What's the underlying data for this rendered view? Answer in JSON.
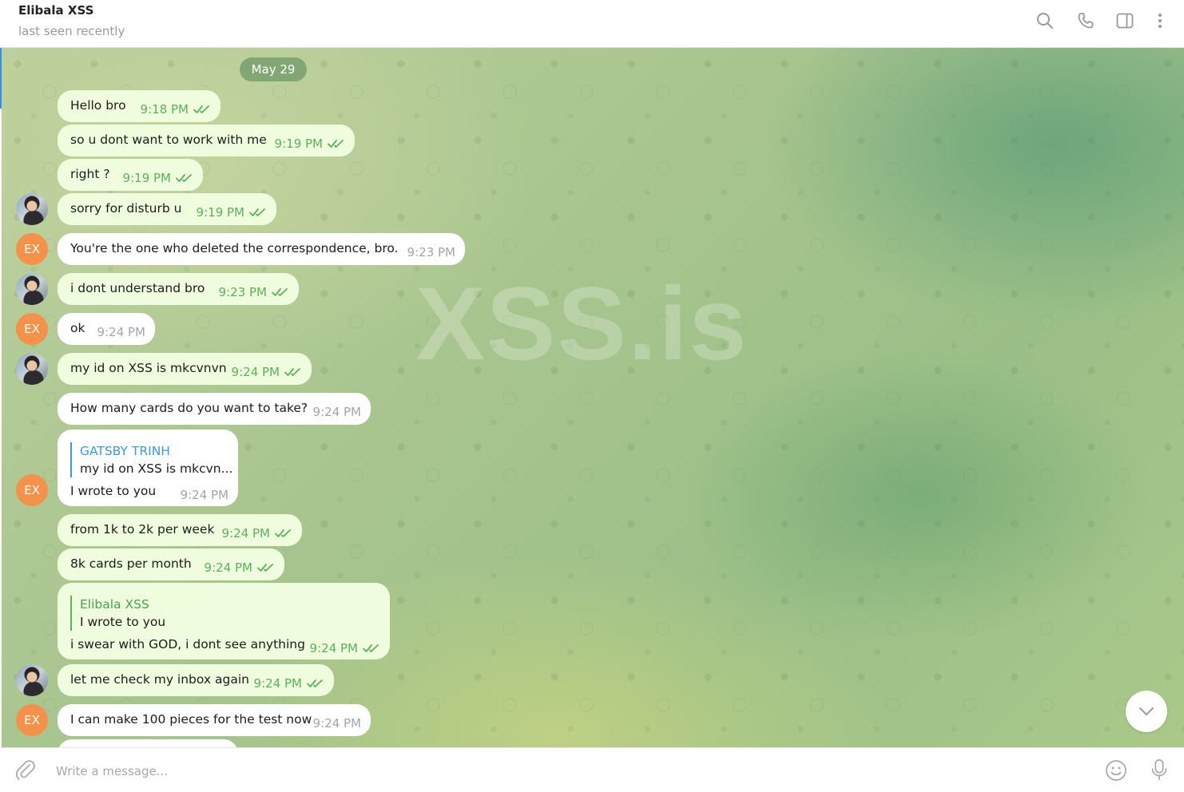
{
  "header": {
    "title": "Elibala XSS",
    "status": "last seen recently",
    "icons": [
      "search-icon",
      "phone-icon",
      "sidebar-toggle-icon",
      "more-vertical-icon"
    ]
  },
  "chat": {
    "date_label": "May 29",
    "watermark": "XSS.is",
    "avatar_initials": "EX",
    "messages": [
      {
        "dir": "out",
        "text": "Hello bro",
        "time": "9:18 PM",
        "read": true
      },
      {
        "dir": "out",
        "text": "so u dont want to work with me",
        "time": "9:19 PM",
        "read": true
      },
      {
        "dir": "out",
        "text": "right ?",
        "time": "9:19 PM",
        "read": true
      },
      {
        "dir": "out",
        "text": "sorry for disturb u",
        "time": "9:19 PM",
        "read": true
      },
      {
        "dir": "in",
        "text": "You're the one who deleted the correspondence, bro.",
        "time": "9:23 PM"
      },
      {
        "dir": "out",
        "text": "i dont understand bro",
        "time": "9:23 PM",
        "read": true
      },
      {
        "dir": "in",
        "text": "ok",
        "time": "9:24 PM"
      },
      {
        "dir": "out",
        "text": "my id on XSS is mkcvnvn",
        "time": "9:24 PM",
        "read": true
      },
      {
        "dir": "in",
        "text": "How many cards do you want to take?",
        "time": "9:24 PM"
      },
      {
        "dir": "in",
        "text": "I wrote to you",
        "time": "9:24 PM",
        "reply_name": "GATSBY TRINH",
        "reply_text": "my id on XSS is mkcvn..."
      },
      {
        "dir": "out",
        "text": "from 1k to 2k per week",
        "time": "9:24 PM",
        "read": true
      },
      {
        "dir": "out",
        "text": "8k cards per month",
        "time": "9:24 PM",
        "read": true
      },
      {
        "dir": "out",
        "text": "i swear with GOD, i dont see anything",
        "time": "9:24 PM",
        "read": true,
        "reply_name": "Elibala XSS",
        "reply_text": "I wrote to you"
      },
      {
        "dir": "out",
        "text": "let me check my inbox again",
        "time": "9:24 PM",
        "read": true
      },
      {
        "dir": "in",
        "text": "I can make 100 pieces for the test now",
        "time": "9:24 PM"
      }
    ]
  },
  "composer": {
    "placeholder": "Write a message...",
    "icons": [
      "paperclip-icon",
      "emoji-icon",
      "microphone-icon"
    ]
  },
  "colors": {
    "outgoing_bubble": "#effdde",
    "incoming_bubble": "#ffffff",
    "time_outgoing": "#5cb15a",
    "avatar_ex": "#f4914a",
    "accent_blue": "#3d98d6"
  }
}
